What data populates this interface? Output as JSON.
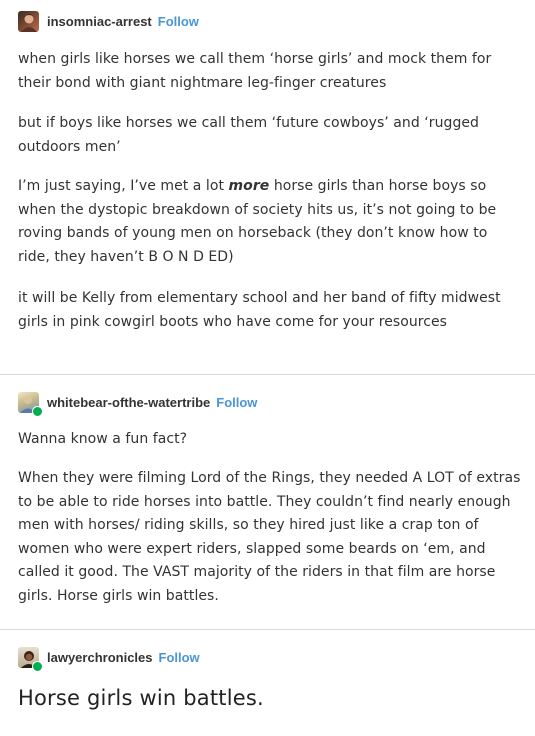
{
  "posts": [
    {
      "username": "insomniac-arrest",
      "follow_label": "Follow",
      "avatar_colors": [
        "#3a2a22",
        "#c76d4e"
      ],
      "paragraphs": [
        {
          "text": "when girls like horses we call them ‘horse girls’ and mock them for their bond with giant nightmare leg-finger creatures"
        },
        {
          "text": "but if boys like horses we call them ‘future cowboys’ and ‘rugged outdoors men’"
        },
        {
          "before": "I’m just saying, I’ve met a lot ",
          "emphasis": "more",
          "after": " horse girls than horse boys so when the dystopic breakdown of society hits us, it’s not going to be roving bands of young men on horseback (they don’t know how to ride, they haven’t B O N D ED)"
        },
        {
          "text": "it will be Kelly from elementary school and her band of fifty midwest girls in pink cowgirl boots who have come for your resources"
        }
      ]
    },
    {
      "username": "whitebear-ofthe-watertribe",
      "follow_label": "Follow",
      "avatar_colors": [
        "#e8d9a8",
        "#6f8fb8"
      ],
      "paragraphs": [
        {
          "text": "Wanna know a fun fact?"
        },
        {
          "text": "When they were filming Lord of the Rings, they needed A LOT of extras to be able to ride horses into battle. They couldn’t find nearly enough men with horses/ riding skills, so they hired just like a crap ton of women who were expert riders, slapped some beards on ‘em, and called it good. The VAST majority of the riders in that film are horse girls. Horse girls win battles."
        }
      ]
    },
    {
      "username": "lawyerchronicles",
      "follow_label": "Follow",
      "avatar_colors": [
        "#2a1d14",
        "#e8e0d0"
      ],
      "big_text": "Horse girls win battles."
    }
  ]
}
